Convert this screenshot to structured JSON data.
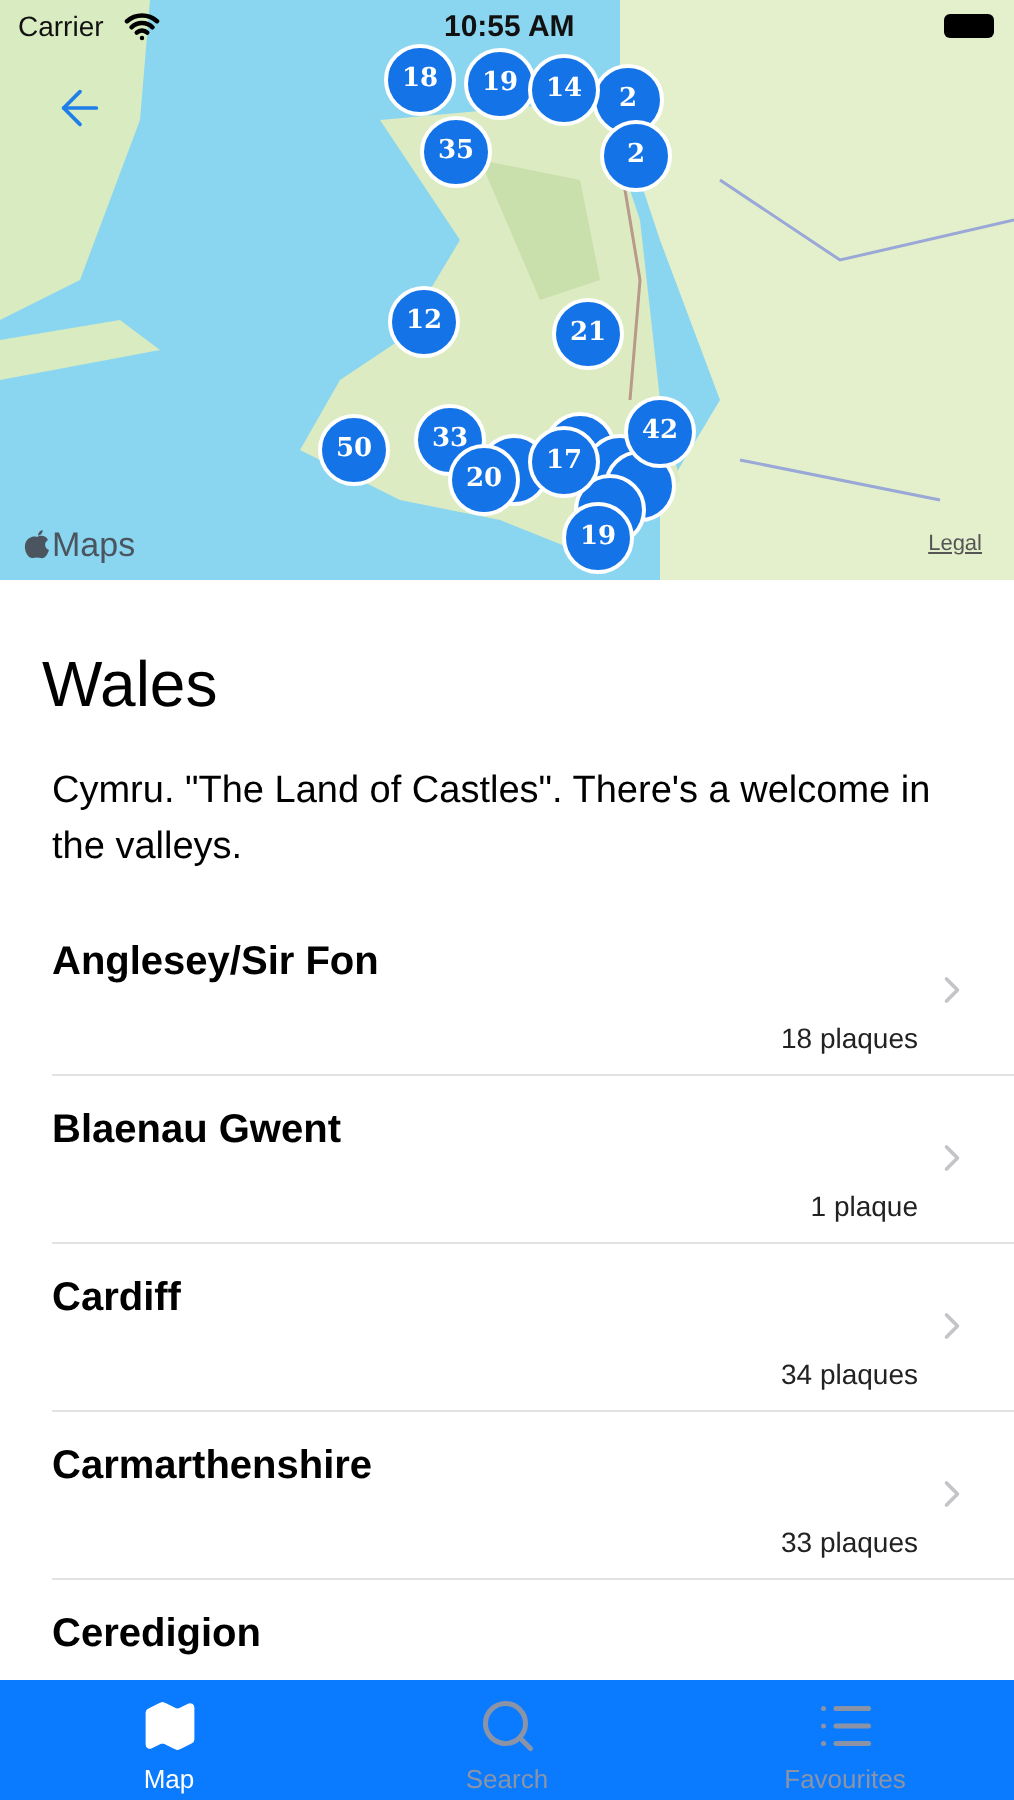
{
  "status_bar": {
    "carrier": "Carrier",
    "time": "10:55 AM"
  },
  "map": {
    "markers": [
      {
        "label": "18"
      },
      {
        "label": "19"
      },
      {
        "label": "14"
      },
      {
        "label": "2"
      },
      {
        "label": "35"
      },
      {
        "label": "2"
      },
      {
        "label": "12"
      },
      {
        "label": "21"
      },
      {
        "label": "50"
      },
      {
        "label": "33"
      },
      {
        "label": "20"
      },
      {
        "label": "17"
      },
      {
        "label": "42"
      },
      {
        "label": "19"
      }
    ],
    "attribution": "Maps",
    "legal": "Legal"
  },
  "region": {
    "title": "Wales",
    "description": "Cymru. \"The Land of Castles\". There's a welcome in the valleys."
  },
  "counties": [
    {
      "name": "Anglesey/Sir Fon",
      "count": "18 plaques"
    },
    {
      "name": "Blaenau Gwent",
      "count": "1 plaque"
    },
    {
      "name": "Cardiff",
      "count": "34 plaques"
    },
    {
      "name": "Carmarthenshire",
      "count": "33 plaques"
    },
    {
      "name": "Ceredigion"
    }
  ],
  "tabs": [
    {
      "label": "Map",
      "kind": "map",
      "selected": true
    },
    {
      "label": "Search",
      "kind": "search",
      "selected": false
    },
    {
      "label": "Favourites",
      "kind": "list",
      "selected": false
    }
  ]
}
